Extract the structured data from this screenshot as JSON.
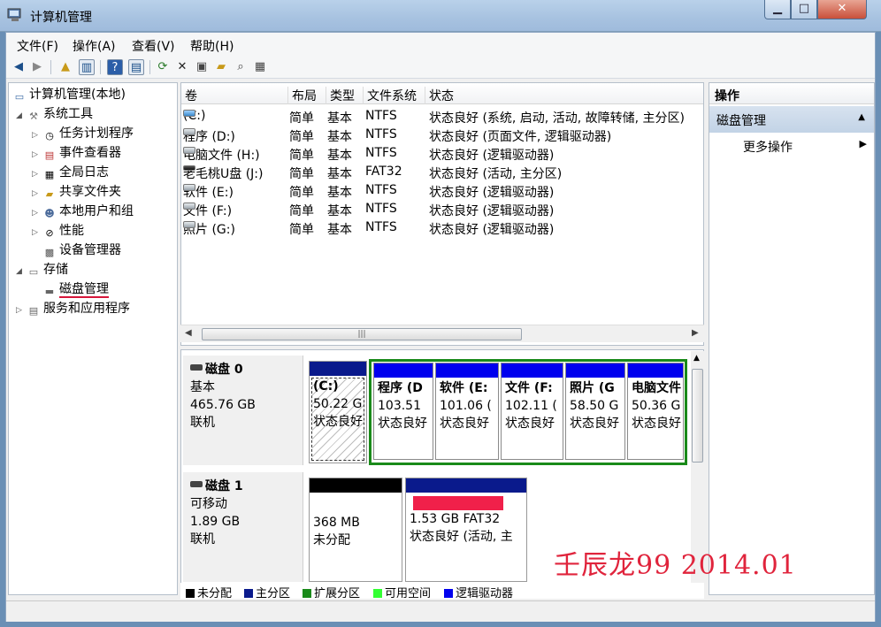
{
  "window": {
    "title": "计算机管理",
    "min": "▁",
    "max": "□",
    "close": "✕"
  },
  "menu": [
    "文件(F)",
    "操作(A)",
    "查看(V)",
    "帮助(H)"
  ],
  "tree": {
    "root": "计算机管理(本地)",
    "system_tools": "系统工具",
    "task_scheduler": "任务计划程序",
    "event_viewer": "事件查看器",
    "global_log": "全局日志",
    "shared_folders": "共享文件夹",
    "local_users": "本地用户和组",
    "performance": "性能",
    "device_manager": "设备管理器",
    "storage": "存储",
    "disk_management": "磁盘管理",
    "services_apps": "服务和应用程序"
  },
  "columns": [
    "卷",
    "布局",
    "类型",
    "文件系统",
    "状态"
  ],
  "volumes": [
    [
      "(C:)",
      "简单",
      "基本",
      "NTFS",
      "状态良好 (系统, 启动, 活动, 故障转储, 主分区)"
    ],
    [
      "程序 (D:)",
      "简单",
      "基本",
      "NTFS",
      "状态良好 (页面文件, 逻辑驱动器)"
    ],
    [
      "电脑文件 (H:)",
      "简单",
      "基本",
      "NTFS",
      "状态良好 (逻辑驱动器)"
    ],
    [
      "老毛桃U盘 (J:)",
      "简单",
      "基本",
      "FAT32",
      "状态良好 (活动, 主分区)"
    ],
    [
      "软件 (E:)",
      "简单",
      "基本",
      "NTFS",
      "状态良好 (逻辑驱动器)"
    ],
    [
      "文件 (F:)",
      "简单",
      "基本",
      "NTFS",
      "状态良好 (逻辑驱动器)"
    ],
    [
      "照片 (G:)",
      "简单",
      "基本",
      "NTFS",
      "状态良好 (逻辑驱动器)"
    ]
  ],
  "disk0": {
    "name": "磁盘 0",
    "type": "基本",
    "size": "465.76 GB",
    "status": "联机",
    "partitions": [
      {
        "label": "(C:)",
        "size": "50.22 G",
        "state": "状态良好"
      },
      {
        "label": "程序 (D",
        "size": "103.51",
        "state": "状态良好"
      },
      {
        "label": "软件 (E:",
        "size": "101.06 (",
        "state": "状态良好"
      },
      {
        "label": "文件 (F:",
        "size": "102.11 (",
        "state": "状态良好"
      },
      {
        "label": "照片 (G",
        "size": "58.50 G",
        "state": "状态良好"
      },
      {
        "label": "电脑文件",
        "size": "50.36 G",
        "state": "状态良好"
      }
    ]
  },
  "disk1": {
    "name": "磁盘 1",
    "type": "可移动",
    "size": "1.89 GB",
    "status": "联机",
    "unallocated": {
      "size": "368 MB",
      "state": "未分配"
    },
    "primary": {
      "size": "1.53 GB FAT32",
      "state": "状态良好 (活动, 主"
    }
  },
  "legend": [
    "未分配",
    "主分区",
    "扩展分区",
    "可用空间",
    "逻辑驱动器"
  ],
  "colors": {
    "unallocated": "#000000",
    "primary": "#0a1a8c",
    "extended": "#1a8a1a",
    "free": "#33ff33",
    "logical": "#0000ee",
    "redact": "#f0204a"
  },
  "actions": {
    "header": "操作",
    "section": "磁盘管理",
    "more": "更多操作"
  },
  "watermark": "壬辰龙99 2014.01"
}
